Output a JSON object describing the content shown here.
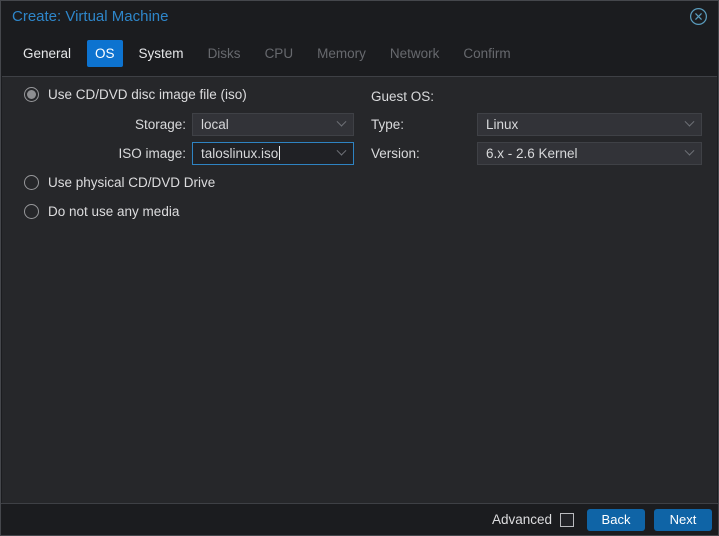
{
  "window": {
    "title": "Create: Virtual Machine"
  },
  "tabs": [
    {
      "label": "General",
      "state": "enabled"
    },
    {
      "label": "OS",
      "state": "active"
    },
    {
      "label": "System",
      "state": "enabled"
    },
    {
      "label": "Disks",
      "state": "disabled"
    },
    {
      "label": "CPU",
      "state": "disabled"
    },
    {
      "label": "Memory",
      "state": "disabled"
    },
    {
      "label": "Network",
      "state": "disabled"
    },
    {
      "label": "Confirm",
      "state": "disabled"
    }
  ],
  "media": {
    "options": [
      {
        "label": "Use CD/DVD disc image file (iso)",
        "selected": true
      },
      {
        "label": "Use physical CD/DVD Drive",
        "selected": false
      },
      {
        "label": "Do not use any media",
        "selected": false
      }
    ],
    "storage": {
      "label": "Storage:",
      "value": "local"
    },
    "iso_image": {
      "label": "ISO image:",
      "value": "taloslinux.iso",
      "focused": true
    }
  },
  "guest_os": {
    "heading": "Guest OS:",
    "type": {
      "label": "Type:",
      "value": "Linux"
    },
    "version": {
      "label": "Version:",
      "value": "6.x - 2.6 Kernel"
    }
  },
  "footer": {
    "advanced_label": "Advanced",
    "advanced_checked": false,
    "back_label": "Back",
    "next_label": "Next"
  },
  "icons": {
    "close": "circled-x-icon",
    "dropdown": "chevron-down-icon"
  },
  "colors": {
    "active_tab_blue": "#0d73d0",
    "button_blue": "#0f64a6",
    "title_blue": "#2e86ca",
    "focus_border_blue": "#2e83c2",
    "panel_background": "#26272a",
    "frame_background": "#1b1c1f"
  }
}
